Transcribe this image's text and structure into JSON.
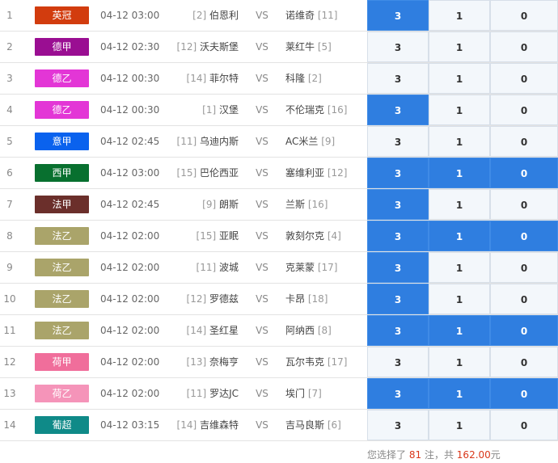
{
  "matches": [
    {
      "idx": "1",
      "league": "英冠",
      "league_color": "#d23c0e",
      "time": "04-12 03:00",
      "home_rank": "[2]",
      "home": "伯恩利",
      "vs": "VS",
      "away": "诺维奇",
      "away_rank": "[11]",
      "odds": [
        "3",
        "1",
        "0"
      ],
      "selected": [
        true,
        false,
        false
      ]
    },
    {
      "idx": "2",
      "league": "德甲",
      "league_color": "#9a0e92",
      "time": "04-12 02:30",
      "home_rank": "[12]",
      "home": "沃夫斯堡",
      "vs": "VS",
      "away": "莱红牛",
      "away_rank": "[5]",
      "odds": [
        "3",
        "1",
        "0"
      ],
      "selected": [
        false,
        false,
        false
      ]
    },
    {
      "idx": "3",
      "league": "德乙",
      "league_color": "#e336d6",
      "time": "04-12 00:30",
      "home_rank": "[14]",
      "home": "菲尔特",
      "vs": "VS",
      "away": "科隆",
      "away_rank": "[2]",
      "odds": [
        "3",
        "1",
        "0"
      ],
      "selected": [
        false,
        false,
        false
      ]
    },
    {
      "idx": "4",
      "league": "德乙",
      "league_color": "#e336d6",
      "time": "04-12 00:30",
      "home_rank": "[1]",
      "home": "汉堡",
      "vs": "VS",
      "away": "不伦瑞克",
      "away_rank": "[16]",
      "odds": [
        "3",
        "1",
        "0"
      ],
      "selected": [
        true,
        false,
        false
      ]
    },
    {
      "idx": "5",
      "league": "意甲",
      "league_color": "#0a62ee",
      "time": "04-12 02:45",
      "home_rank": "[11]",
      "home": "乌迪内斯",
      "vs": "VS",
      "away": "AC米兰",
      "away_rank": "[9]",
      "odds": [
        "3",
        "1",
        "0"
      ],
      "selected": [
        false,
        false,
        false
      ]
    },
    {
      "idx": "6",
      "league": "西甲",
      "league_color": "#08702f",
      "time": "04-12 03:00",
      "home_rank": "[15]",
      "home": "巴伦西亚",
      "vs": "VS",
      "away": "塞维利亚",
      "away_rank": "[12]",
      "odds": [
        "3",
        "1",
        "0"
      ],
      "selected": [
        true,
        true,
        true
      ]
    },
    {
      "idx": "7",
      "league": "法甲",
      "league_color": "#6b2f2b",
      "time": "04-12 02:45",
      "home_rank": "[9]",
      "home": "朗斯",
      "vs": "VS",
      "away": "兰斯",
      "away_rank": "[16]",
      "odds": [
        "3",
        "1",
        "0"
      ],
      "selected": [
        true,
        false,
        false
      ]
    },
    {
      "idx": "8",
      "league": "法乙",
      "league_color": "#aaa46a",
      "time": "04-12 02:00",
      "home_rank": "[15]",
      "home": "亚眠",
      "vs": "VS",
      "away": "敦刻尔克",
      "away_rank": "[4]",
      "odds": [
        "3",
        "1",
        "0"
      ],
      "selected": [
        true,
        true,
        true
      ]
    },
    {
      "idx": "9",
      "league": "法乙",
      "league_color": "#aaa46a",
      "time": "04-12 02:00",
      "home_rank": "[11]",
      "home": "波城",
      "vs": "VS",
      "away": "克莱蒙",
      "away_rank": "[17]",
      "odds": [
        "3",
        "1",
        "0"
      ],
      "selected": [
        true,
        false,
        false
      ]
    },
    {
      "idx": "10",
      "league": "法乙",
      "league_color": "#aaa46a",
      "time": "04-12 02:00",
      "home_rank": "[12]",
      "home": "罗德兹",
      "vs": "VS",
      "away": "卡昂",
      "away_rank": "[18]",
      "odds": [
        "3",
        "1",
        "0"
      ],
      "selected": [
        true,
        false,
        false
      ]
    },
    {
      "idx": "11",
      "league": "法乙",
      "league_color": "#aaa46a",
      "time": "04-12 02:00",
      "home_rank": "[14]",
      "home": "圣红星",
      "vs": "VS",
      "away": "阿纳西",
      "away_rank": "[8]",
      "odds": [
        "3",
        "1",
        "0"
      ],
      "selected": [
        true,
        true,
        true
      ]
    },
    {
      "idx": "12",
      "league": "荷甲",
      "league_color": "#f06e9b",
      "time": "04-12 02:00",
      "home_rank": "[13]",
      "home": "奈梅亨",
      "vs": "VS",
      "away": "瓦尔韦克",
      "away_rank": "[17]",
      "odds": [
        "3",
        "1",
        "0"
      ],
      "selected": [
        false,
        false,
        false
      ]
    },
    {
      "idx": "13",
      "league": "荷乙",
      "league_color": "#f594b9",
      "time": "04-12 02:00",
      "home_rank": "[11]",
      "home": "罗达JC",
      "vs": "VS",
      "away": "埃门",
      "away_rank": "[7]",
      "odds": [
        "3",
        "1",
        "0"
      ],
      "selected": [
        true,
        true,
        true
      ]
    },
    {
      "idx": "14",
      "league": "葡超",
      "league_color": "#0f8a88",
      "time": "04-12 03:15",
      "home_rank": "[14]",
      "home": "吉维森特",
      "vs": "VS",
      "away": "吉马良斯",
      "away_rank": "[6]",
      "odds": [
        "3",
        "1",
        "0"
      ],
      "selected": [
        false,
        false,
        false
      ]
    }
  ],
  "footer": {
    "prefix": "您选择了",
    "count": "81",
    "mid": "注，共",
    "amount": "162.00",
    "suffix": "元"
  },
  "colors": {
    "selected": "#2f7ee0",
    "unselected": "#f3f7fb",
    "highlight_text": "#d9371a"
  }
}
